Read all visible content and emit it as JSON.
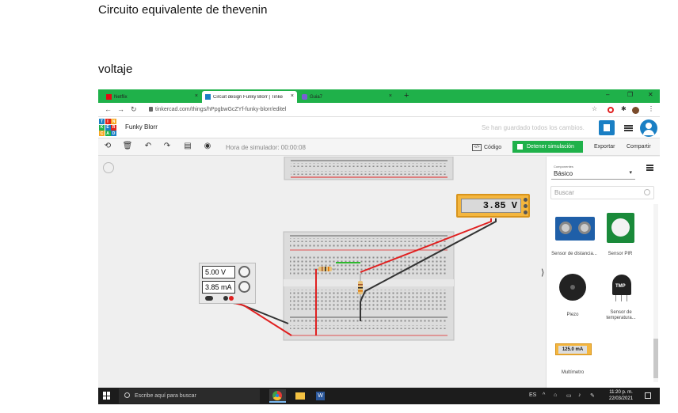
{
  "doc": {
    "heading": "Circuito equivalente de thevenin",
    "section": "voltaje"
  },
  "browser": {
    "tabs": [
      {
        "label": "Netflix",
        "icon": "netflix-icon"
      },
      {
        "label": "Circuit design Funky Blorr | Tinke",
        "icon": "tinkercad-icon"
      },
      {
        "label": "Guia7",
        "icon": "guia-icon"
      }
    ],
    "url": "tinkercad.com/things/hPpgbwGcZYf-funky-blorr/editel"
  },
  "app": {
    "logo_letters": [
      "T",
      "I",
      "N",
      "K",
      "E",
      "R",
      "C",
      "A",
      "D"
    ],
    "project_name": "Funky Blorr",
    "save_status": "Se han guardado todos los cambios."
  },
  "toolbar": {
    "sim_time": "Hora de simulador: 00:00:08",
    "code_label": "Código",
    "stop_label": "Detener simulación",
    "export_label": "Exportar",
    "share_label": "Compartir"
  },
  "canvas": {
    "multimeter_reading": "3.85 V",
    "psu_voltage": "5.00 V",
    "psu_current": "3.85 mA"
  },
  "panel": {
    "components_caption": "Componentes",
    "category": "Básico",
    "search_placeholder": "Buscar",
    "components": [
      {
        "label": "Sensor de distancia...",
        "icon": "ultrasonic-sensor-icon"
      },
      {
        "label": "Sensor PIR",
        "icon": "pir-sensor-icon"
      },
      {
        "label": "Piezo",
        "icon": "piezo-icon"
      },
      {
        "label": "Sensor de temperatura...",
        "icon": "temperature-sensor-icon"
      },
      {
        "label": "Multímetro",
        "icon": "multimeter-icon"
      }
    ],
    "multimeter_thumb_reading": "125.0 mA",
    "tmp_label": "TMP"
  },
  "taskbar": {
    "search_placeholder": "Escribe aquí para buscar",
    "language": "ES",
    "time": "11:20 p. m.",
    "date": "22/03/2021"
  },
  "colors": {
    "brand_green": "#1fb14a",
    "tinkercad_blue": "#1a7fc4",
    "wire_red": "#e02020",
    "wire_black": "#333333",
    "multimeter_orange": "#f4b63e"
  }
}
